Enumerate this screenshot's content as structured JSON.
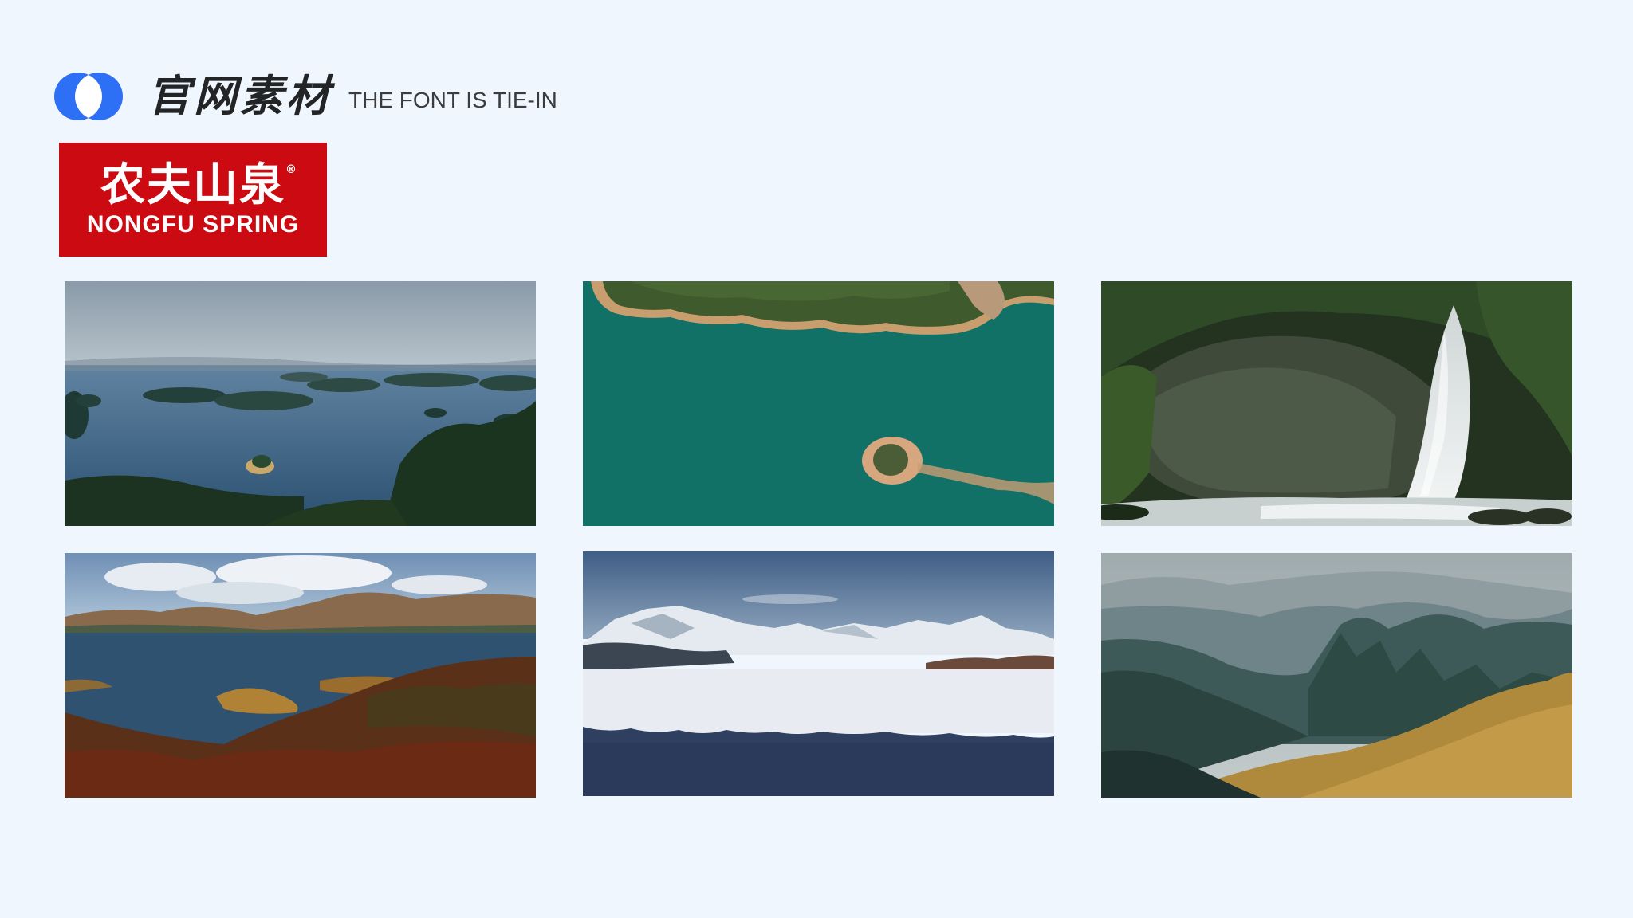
{
  "header": {
    "title": "官网素材",
    "subtitle": "THE FONT IS TIE-IN",
    "logo_icon": "overlapping-circles-logo"
  },
  "brand": {
    "name_cn": "农夫山泉",
    "registered_mark": "®",
    "name_en": "NONGFU SPRING",
    "color": "#cc0a12"
  },
  "colors": {
    "background": "#f0f6fd",
    "logo_blue": "#2d6ff5"
  },
  "photos": [
    {
      "subject": "lake-islands"
    },
    {
      "subject": "aerial-turquoise-lake"
    },
    {
      "subject": "forest-waterfall"
    },
    {
      "subject": "autumn-lake-hills"
    },
    {
      "subject": "snowy-mountains-river"
    },
    {
      "subject": "misty-mountain-range"
    }
  ]
}
